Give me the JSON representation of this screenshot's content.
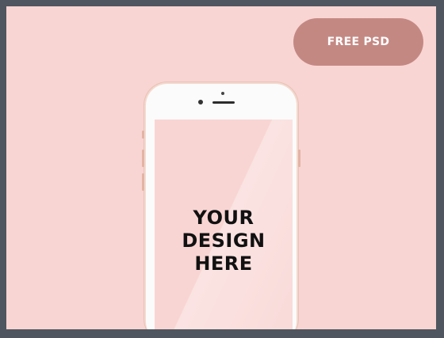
{
  "badge": {
    "label": "FREE PSD"
  },
  "screen": {
    "line1": "YOUR",
    "line2": "DESIGN",
    "line3": "HERE"
  },
  "colors": {
    "frame": "#4f565f",
    "background": "#f8d5d3",
    "badge": "#c48883",
    "phone_body": "#fbfbfb"
  }
}
